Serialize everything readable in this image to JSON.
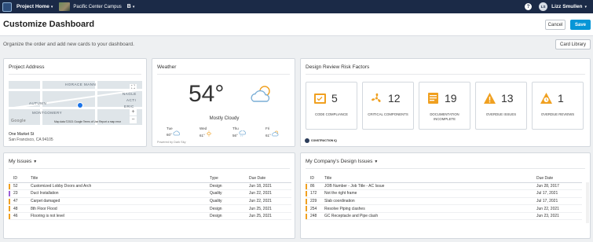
{
  "topbar": {
    "project_label": "Project Home",
    "campus_label": "Pacific Center Campus",
    "b_label": "B",
    "help_label": "?",
    "avatar_initials": "LS",
    "user_name": "Lizz Smullen"
  },
  "header": {
    "title": "Customize Dashboard",
    "cancel_label": "Cancel",
    "save_label": "Save",
    "subtitle": "Organize the order and add new cards to your dashboard.",
    "library_label": "Card Library"
  },
  "address_card": {
    "title": "Project Address",
    "map_labels": [
      "HORACE MANN",
      "AUTUMN",
      "MONTGOMERY",
      "NAGLE",
      "ACTI",
      "ERIC"
    ],
    "map_credits": "Map data ©2021 Google   Terms of Use   Report a map error",
    "google_label": "Google",
    "line1": "One Market St",
    "line2": "San Francisco, CA 94105"
  },
  "weather_card": {
    "title": "Weather",
    "temperature": "54°",
    "condition": "Mostly Cloudy",
    "forecast": [
      {
        "day": "Tue",
        "temp": "60°"
      },
      {
        "day": "Wed",
        "temp": "61°"
      },
      {
        "day": "Thu",
        "temp": "56°"
      },
      {
        "day": "Fri",
        "temp": "61°"
      }
    ],
    "powered": "Powered by Dark Sky"
  },
  "risk_card": {
    "title": "Design Review Risk Factors",
    "items": [
      {
        "count": "5",
        "label": "CODE COMPLIANCE",
        "icon": "checklist-icon"
      },
      {
        "count": "12",
        "label": "CRITICAL COMPONENTS",
        "icon": "fan-icon"
      },
      {
        "count": "19",
        "label": "DOCUMENTATION INCOMPLETE",
        "icon": "document-icon"
      },
      {
        "count": "13",
        "label": "OVERDUE ISSUES",
        "icon": "warning-icon"
      },
      {
        "count": "1",
        "label": "OVERDUE REVIEWS",
        "icon": "clock-icon"
      }
    ],
    "brand": "CONSTRUCTION IQ"
  },
  "my_issues": {
    "title": "My Issues",
    "columns": [
      "ID",
      "Title",
      "Type",
      "Due Date"
    ],
    "rows": [
      {
        "id": "52",
        "title": "Customized Lobby Doors and Arch",
        "type": "Design",
        "due": "Jun 18, 2021",
        "color": "#f0a020"
      },
      {
        "id": "23",
        "title": "Duct Installation",
        "type": "Quality",
        "due": "Jun 22, 2021",
        "color": "#9c5fd6"
      },
      {
        "id": "47",
        "title": "Carpet damaged",
        "type": "Quality",
        "due": "Jun 22, 2021",
        "color": "#f0a020"
      },
      {
        "id": "48",
        "title": "8th Floor Flood",
        "type": "Design",
        "due": "Jun 25, 2021",
        "color": "#f0a020"
      },
      {
        "id": "46",
        "title": "Flooring is not level",
        "type": "Design",
        "due": "Jun 25, 2021",
        "color": "#f0a020"
      }
    ]
  },
  "company_issues": {
    "title": "My Company's Design Issues",
    "columns": [
      "ID",
      "Title",
      "Due Date"
    ],
    "rows": [
      {
        "id": "86",
        "title": "JOB Number - Job Title - AC Issue",
        "due": "Jun 28, 2017",
        "color": "#f0a020"
      },
      {
        "id": "172",
        "title": "Not the right frame",
        "due": "Jul 17, 2021",
        "color": "#f0a020"
      },
      {
        "id": "229",
        "title": "Slab coordination",
        "due": "Jul 17, 2021",
        "color": "#f0a020"
      },
      {
        "id": "254",
        "title": "Resolve Piping clashes",
        "due": "Jun 22, 2021",
        "color": "#f0a020"
      },
      {
        "id": "248",
        "title": "GC Receptacle and Pipe clash",
        "due": "Jun 23, 2021",
        "color": "#f0a020"
      }
    ]
  },
  "colors": {
    "topbar": "#1b2a47",
    "primary": "#0696d7",
    "risk_orange": "#f0a020",
    "weather_blue": "#7aaed6"
  }
}
